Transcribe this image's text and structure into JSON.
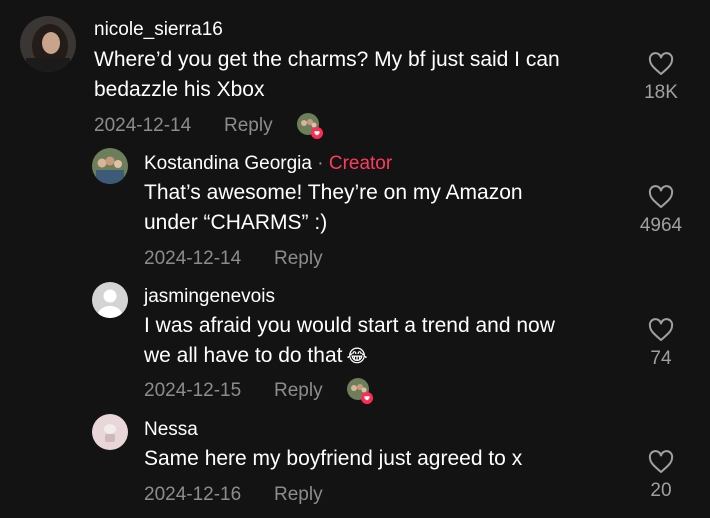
{
  "comments": [
    {
      "username": "nicole_sierra16",
      "text_line1": "Where’d you get the charms? My bf just said I can",
      "text_line2": "bedazzle his Xbox",
      "date": "2024-12-14",
      "reply_label": "Reply",
      "likes": "18K",
      "liked_by_creator": true
    },
    {
      "username": "Kostandina Georgia",
      "separator": "·",
      "creator_label": "Creator",
      "text_line1": "That’s awesome! They’re on my Amazon",
      "text_line2": "under “CHARMS” :)",
      "date": "2024-12-14",
      "reply_label": "Reply",
      "likes": "4964",
      "liked_by_creator": false
    },
    {
      "username": "jasmingenevois",
      "text_line1": "I was afraid you would start a trend and now",
      "text_line2": "we all have to do that",
      "emoji": "😂",
      "date": "2024-12-15",
      "reply_label": "Reply",
      "likes": "74",
      "liked_by_creator": true
    },
    {
      "username": "Nessa",
      "text_line1": "Same here my boyfriend just agreed to x",
      "date": "2024-12-16",
      "reply_label": "Reply",
      "likes": "20",
      "liked_by_creator": false
    }
  ],
  "colors": {
    "background": "#131313",
    "meta": "#8c8c8c",
    "creator": "#ff3b5c"
  }
}
